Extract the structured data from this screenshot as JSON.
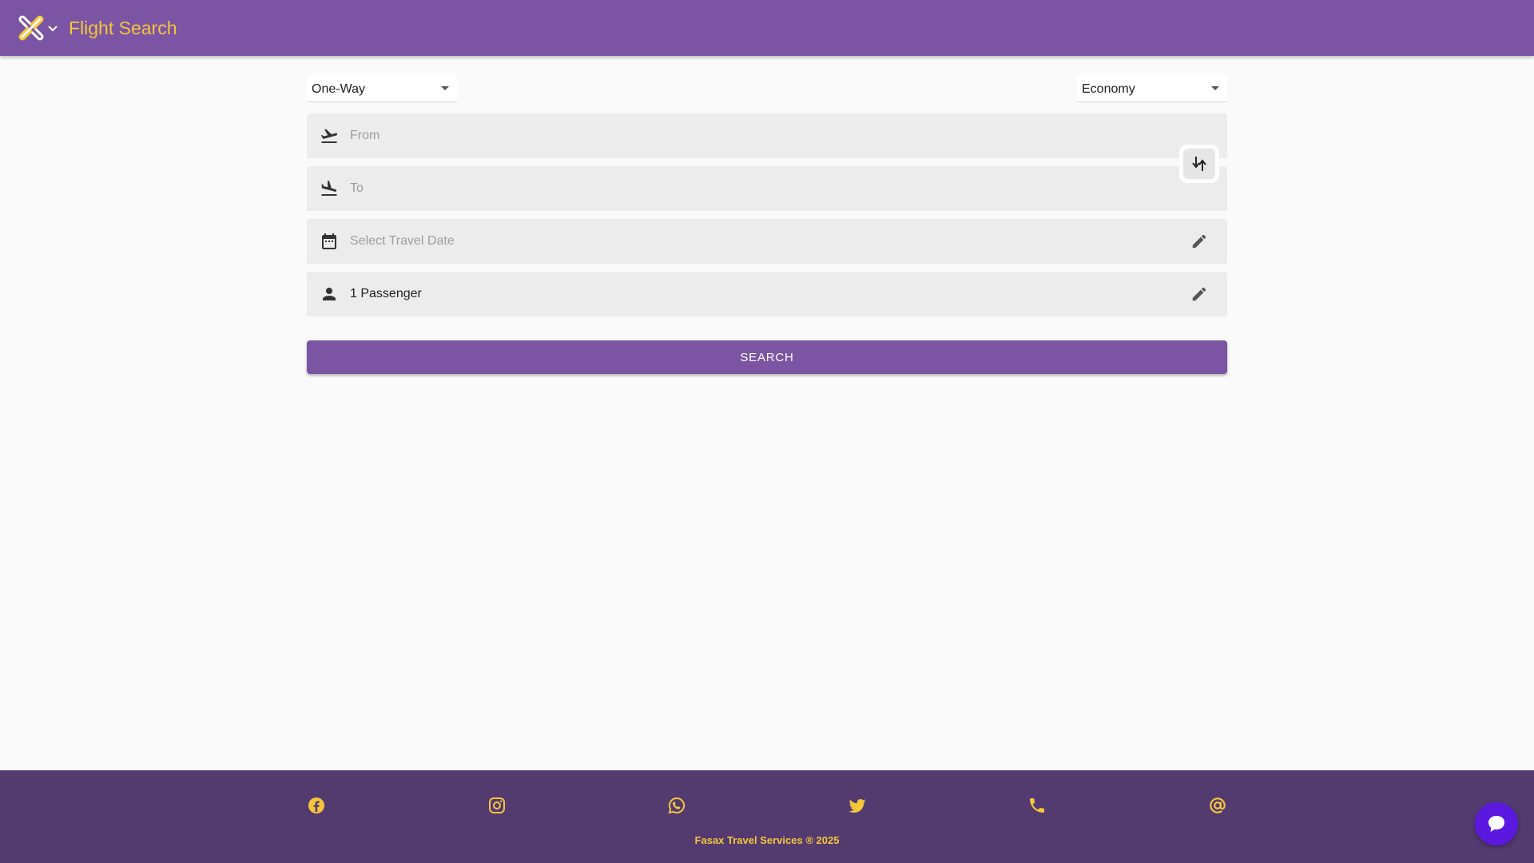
{
  "header": {
    "title": "Flight Search",
    "logo_icon": "crossed-logo-icon",
    "menu_icon": "chevron-down-icon"
  },
  "trip_type": {
    "selected": "One-Way"
  },
  "cabin_class": {
    "selected": "Economy"
  },
  "fields": {
    "from_placeholder": "From",
    "to_placeholder": "To",
    "date_placeholder": "Select Travel Date",
    "passengers_value": "1 Passenger"
  },
  "swap_icon": "swap-vertical-icon",
  "search_button": {
    "label": "SEARCH"
  },
  "footer": {
    "icons": [
      "facebook-icon",
      "instagram-icon",
      "whatsapp-icon",
      "twitter-icon",
      "phone-icon",
      "at-sign-icon"
    ],
    "copyright": "Fasax Travel Services ® 2025"
  },
  "colors": {
    "primary": "#7b55a3",
    "accent": "#f5c53b",
    "footer": "#533b70",
    "chat": "#5b19e0"
  }
}
